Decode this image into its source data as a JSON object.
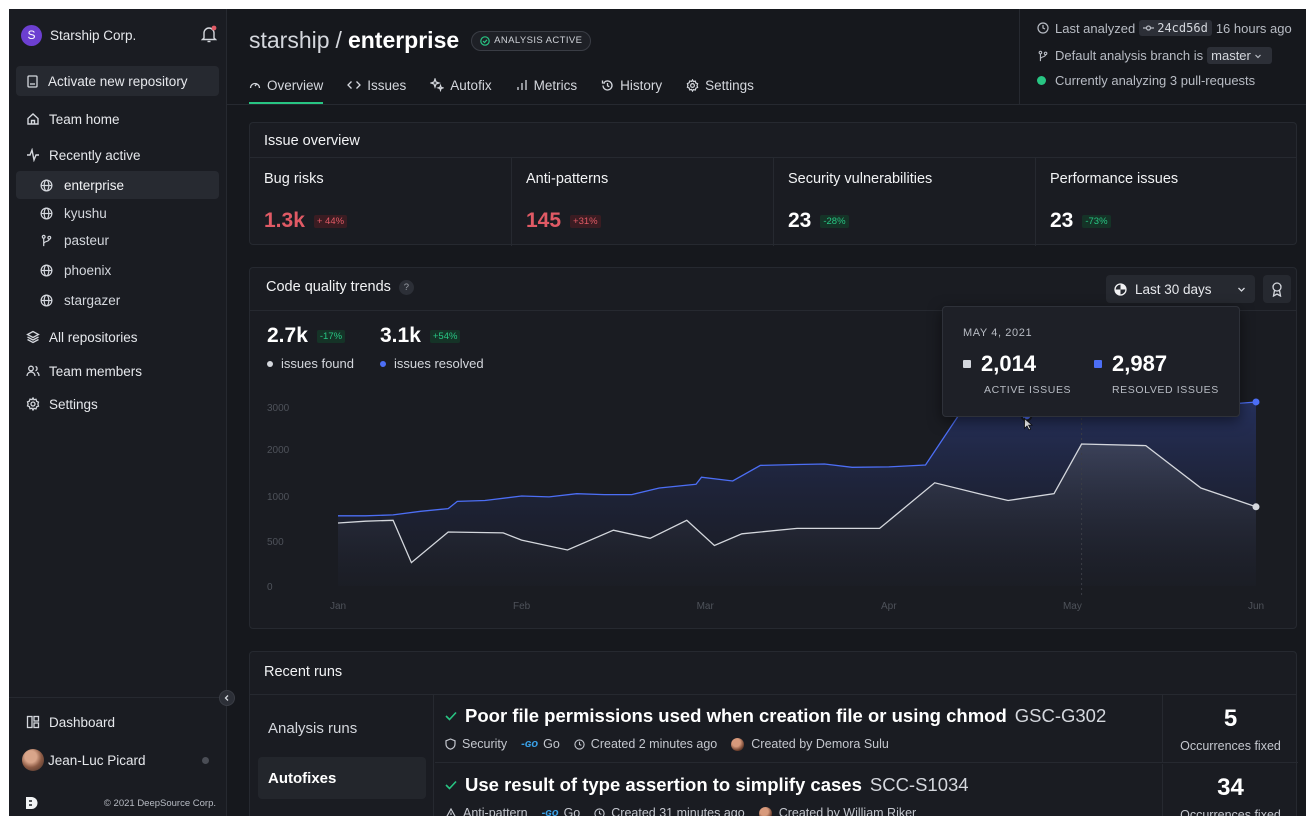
{
  "sidebar": {
    "org_initial": "S",
    "org_name": "Starship Corp.",
    "activate_label": "Activate new repository",
    "team_home": "Team home",
    "recently_active": "Recently active",
    "repos": [
      {
        "name": "enterprise",
        "icon": "globe-icon",
        "active": true
      },
      {
        "name": "kyushu",
        "icon": "globe-icon",
        "active": false
      },
      {
        "name": "pasteur",
        "icon": "git-branch-icon",
        "active": false
      },
      {
        "name": "phoenix",
        "icon": "globe-icon",
        "active": false
      },
      {
        "name": "stargazer",
        "icon": "globe-icon",
        "active": false
      }
    ],
    "all_repos": "All repositories",
    "team_members": "Team members",
    "settings": "Settings",
    "dashboard": "Dashboard",
    "user_name": "Jean-Luc Picard",
    "copyright": "© 2021 DeepSource Corp."
  },
  "header": {
    "owner": "starship",
    "separator": "/",
    "repo": "enterprise",
    "badge": "ANALYSIS ACTIVE",
    "tabs": [
      "Overview",
      "Issues",
      "Autofix",
      "Metrics",
      "History",
      "Settings"
    ],
    "active_tab": "Overview",
    "status": {
      "last_analyzed_prefix": "Last analyzed",
      "commit": "24cd56d",
      "last_analyzed_suffix": "16 hours ago",
      "branch_prefix": "Default analysis branch is",
      "branch": "master",
      "analyzing": "Currently analyzing 3 pull-requests"
    }
  },
  "issue_overview": {
    "title": "Issue overview",
    "metrics": [
      {
        "label": "Bug risks",
        "value": "1.3k",
        "delta": "+ 44%",
        "trend": "bad"
      },
      {
        "label": "Anti-patterns",
        "value": "145",
        "delta": "+31%",
        "trend": "bad"
      },
      {
        "label": "Security vulnerabilities",
        "value": "23",
        "delta": "-28%",
        "trend": "good"
      },
      {
        "label": "Performance issues",
        "value": "23",
        "delta": "-73%",
        "trend": "good"
      }
    ]
  },
  "trends": {
    "title": "Code quality trends",
    "help": "?",
    "range": "Last 30 days",
    "found_value": "2.7k",
    "found_delta": "-17%",
    "found_label": "issues found",
    "resolved_value": "3.1k",
    "resolved_delta": "+54%",
    "resolved_label": "issues resolved",
    "tooltip": {
      "date": "MAY 4, 2021",
      "active_value": "2,014",
      "active_label": "ACTIVE ISSUES",
      "resolved_value": "2,987",
      "resolved_label": "RESOLVED ISSUES"
    }
  },
  "chart_data": {
    "type": "area",
    "categories": [
      "Jan",
      "Feb",
      "Mar",
      "Apr",
      "May",
      "Jun"
    ],
    "y_ticks": [
      "0",
      "500",
      "1000",
      "2000",
      "3000"
    ],
    "series": [
      {
        "name": "issues resolved",
        "color": "#4c6ef5",
        "points": [
          [
            0,
            780
          ],
          [
            0.15,
            780
          ],
          [
            0.3,
            790
          ],
          [
            0.45,
            830
          ],
          [
            0.6,
            860
          ],
          [
            0.65,
            940
          ],
          [
            0.8,
            950
          ],
          [
            1,
            1000
          ],
          [
            1.15,
            990
          ],
          [
            1.3,
            1050
          ],
          [
            1.45,
            1030
          ],
          [
            1.6,
            1030
          ],
          [
            1.75,
            1170
          ],
          [
            1.95,
            1250
          ],
          [
            1.98,
            1400
          ],
          [
            2.15,
            1320
          ],
          [
            2.3,
            1650
          ],
          [
            2.5,
            1670
          ],
          [
            2.65,
            1680
          ],
          [
            2.8,
            1610
          ],
          [
            3,
            1620
          ],
          [
            3.2,
            1660
          ],
          [
            3.38,
            2800
          ],
          [
            3.6,
            2800
          ],
          [
            3.75,
            2800
          ],
          [
            4.1,
            2900
          ],
          [
            4.3,
            2950
          ],
          [
            4.55,
            3000
          ],
          [
            4.8,
            3050
          ],
          [
            5,
            3120
          ]
        ]
      },
      {
        "name": "issues found",
        "color": "#d4d7dd",
        "points": [
          [
            0,
            700
          ],
          [
            0.15,
            720
          ],
          [
            0.3,
            730
          ],
          [
            0.4,
            260
          ],
          [
            0.6,
            600
          ],
          [
            0.9,
            590
          ],
          [
            1,
            510
          ],
          [
            1.25,
            400
          ],
          [
            1.5,
            620
          ],
          [
            1.7,
            530
          ],
          [
            1.9,
            730
          ],
          [
            2.05,
            450
          ],
          [
            2.2,
            580
          ],
          [
            2.5,
            640
          ],
          [
            2.7,
            640
          ],
          [
            2.95,
            640
          ],
          [
            3.25,
            1280
          ],
          [
            3.5,
            1040
          ],
          [
            3.65,
            950
          ],
          [
            3.9,
            1050
          ],
          [
            4.05,
            2120
          ],
          [
            4.4,
            2080
          ],
          [
            4.7,
            1170
          ],
          [
            5,
            880
          ]
        ]
      }
    ]
  },
  "recent_runs": {
    "title": "Recent runs",
    "tabs": [
      "Analysis runs",
      "Autofixes"
    ],
    "active_tab": "Autofixes",
    "rows": [
      {
        "title": "Poor file permissions used when creation file or using chmod",
        "code": "GSC-G302",
        "category": "Security",
        "category_icon": "shield-icon",
        "language": "Go",
        "created": "Created 2 minutes ago",
        "creator": "Created by Demora Sulu",
        "occurrences": "5",
        "occ_label": "Occurrences fixed"
      },
      {
        "title": "Use result of type assertion to simplify cases",
        "code": "SCC-S1034",
        "category": "Anti-pattern",
        "category_icon": "warning-icon",
        "language": "Go",
        "created": "Created 31 minutes ago",
        "creator": "Created by William Riker",
        "occurrences": "34",
        "occ_label": "Occurrences fixed"
      }
    ]
  },
  "colors": {
    "accent_green": "#28c583",
    "bad_red": "#e05a65",
    "series_blue": "#4c6ef5",
    "background": "#16181d"
  }
}
